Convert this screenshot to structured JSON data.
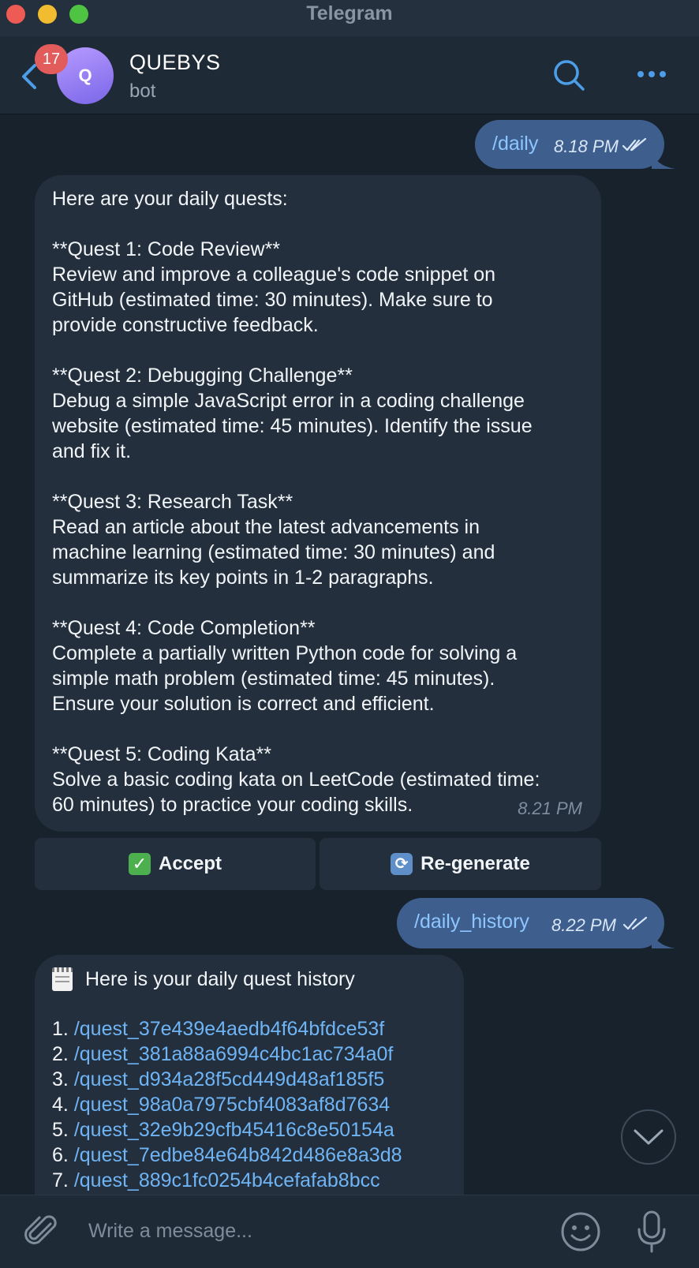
{
  "window": {
    "title": "Telegram"
  },
  "header": {
    "unread_count": "17",
    "avatar_letter": "Q",
    "chat_name": "QUEBYS",
    "chat_subtitle": "bot",
    "icons": [
      "back-chevron-icon",
      "search-icon",
      "more-dots-icon"
    ]
  },
  "messages": {
    "daily_cmd": {
      "text": "/daily",
      "time": "8.18 PM",
      "status": "read-double-check"
    },
    "quests": {
      "text": "Here are your daily quests:\n\n**Quest 1: Code Review**\nReview and improve a colleague's code snippet on\nGitHub (estimated time: 30 minutes). Make sure to\nprovide constructive feedback.\n\n**Quest 2: Debugging Challenge**\nDebug a simple JavaScript error in a coding challenge\nwebsite (estimated time: 45 minutes). Identify the issue\nand fix it.\n\n**Quest 3: Research Task**\nRead an article about the latest advancements in\nmachine learning (estimated time: 30 minutes) and\nsummarize its key points in 1-2 paragraphs.\n\n**Quest 4: Code Completion**\nComplete a partially written Python code for solving a\nsimple math problem (estimated time: 45 minutes).\nEnsure your solution is correct and efficient.\n\n**Quest 5: Coding Kata**\nSolve a basic coding kata on LeetCode (estimated time:\n60 minutes) to practice your coding skills.",
      "time": "8.21 PM"
    },
    "keyboard": {
      "accept_label": "Accept",
      "accept_emoji": "✓",
      "regenerate_label": "Re-generate",
      "regenerate_emoji": "⟳"
    },
    "history_cmd": {
      "text": "/daily_history",
      "time": "8.22 PM",
      "status": "read-double-check"
    },
    "history": {
      "title": "Here is your daily quest history",
      "items": [
        {
          "num": "1.",
          "cmd": "/quest_37e439e4aedb4f64bfdce53f"
        },
        {
          "num": "2.",
          "cmd": "/quest_381a88a6994c4bc1ac734a0f"
        },
        {
          "num": "3.",
          "cmd": "/quest_d934a28f5cd449d48af185f5"
        },
        {
          "num": "4.",
          "cmd": "/quest_98a0a7975cbf4083af8d7634"
        },
        {
          "num": "5.",
          "cmd": "/quest_32e9b29cfb45416c8e50154a"
        },
        {
          "num": "6.",
          "cmd": "/quest_7edbe84e64b842d486e8a3d8"
        },
        {
          "num": "7.",
          "cmd": "/quest_889c1fc0254b4cefafab8bcc"
        }
      ]
    }
  },
  "composer": {
    "placeholder": "Write a message...",
    "icons": [
      "paperclip-icon",
      "emoji-icon",
      "microphone-icon"
    ]
  },
  "colors": {
    "background": "#18222d",
    "outgoing_bubble": "#3e5f8e",
    "incoming_bubble": "#232f3d",
    "link": "#6fb4f5",
    "accent": "#4c9ee8",
    "badge": "#e25c5c"
  }
}
